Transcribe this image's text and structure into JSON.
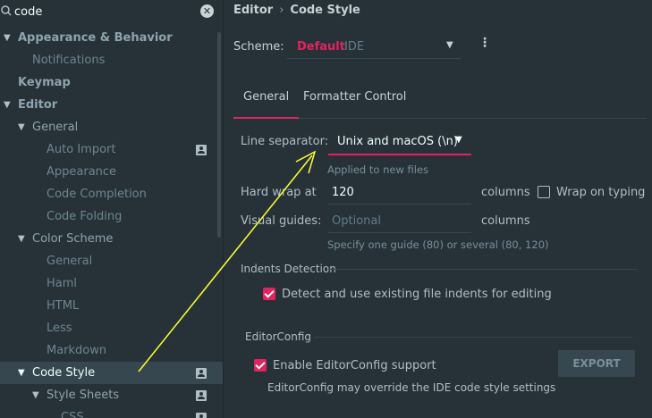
{
  "search": {
    "value": "code"
  },
  "sidebar": {
    "items": [
      {
        "label": "Appearance & Behavior"
      },
      {
        "label": "Notifications"
      },
      {
        "label": "Keymap"
      },
      {
        "label": "Editor"
      },
      {
        "label": "General"
      },
      {
        "label": "Auto Import"
      },
      {
        "label": "Appearance"
      },
      {
        "label": "Code Completion"
      },
      {
        "label": "Code Folding"
      },
      {
        "label": "Color Scheme"
      },
      {
        "label": "General"
      },
      {
        "label": "Haml"
      },
      {
        "label": "HTML"
      },
      {
        "label": "Less"
      },
      {
        "label": "Markdown"
      },
      {
        "label": "Code Style"
      },
      {
        "label": "Style Sheets"
      },
      {
        "label": "CSS"
      }
    ]
  },
  "header": {
    "breadcrumb_root": "Editor",
    "breadcrumb_separator": "›",
    "breadcrumb_current": "Code Style"
  },
  "scheme": {
    "label": "Scheme:",
    "name": "Default",
    "kind": "IDE",
    "menu_glyph": "⋮"
  },
  "tabs": [
    {
      "label": "General"
    },
    {
      "label": "Formatter Control"
    }
  ],
  "general": {
    "line_separator_label": "Line separator:",
    "line_separator_value": "Unix and macOS (\\n)",
    "line_separator_hint": "Applied to new files",
    "hard_wrap_label": "Hard wrap at",
    "hard_wrap_value": "120",
    "hard_wrap_unit": "columns",
    "wrap_on_typing_label": "Wrap on typing",
    "visual_guides_label": "Visual guides:",
    "visual_guides_placeholder": "Optional",
    "visual_guides_unit": "columns",
    "visual_guides_hint": "Specify one guide (80) or several (80, 120)",
    "indents_section": "Indents Detection",
    "detect_indents_label": "Detect and use existing file indents for editing",
    "editorconfig_section": "EditorConfig",
    "enable_editorconfig_label": "Enable EditorConfig support",
    "editorconfig_note": "EditorConfig may override the IDE code style settings",
    "export_label": "EXPORT"
  },
  "colors": {
    "accent": "#E0245E",
    "background": "#263238",
    "annotation_arrow": "#FFFF33"
  }
}
